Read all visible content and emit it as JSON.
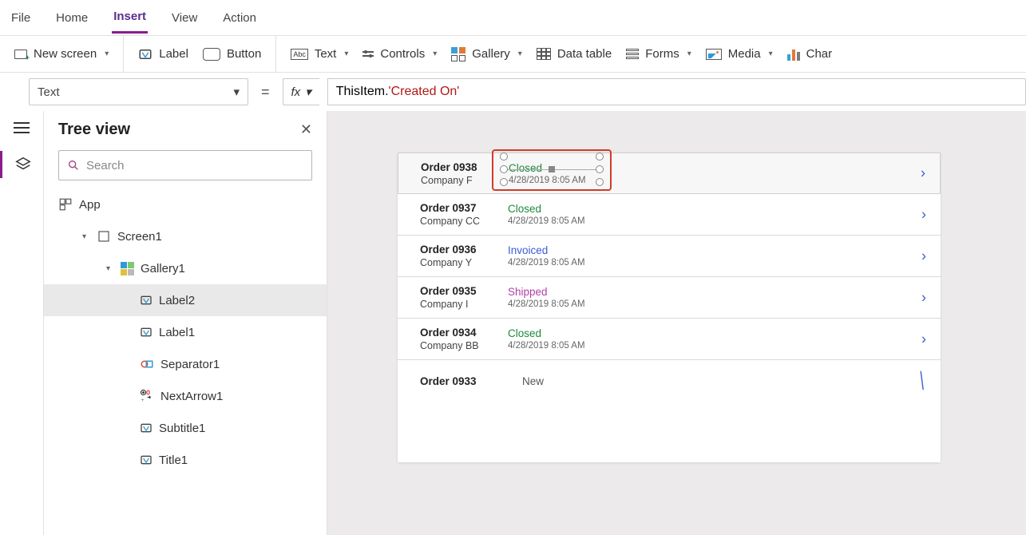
{
  "menu": {
    "file": "File",
    "home": "Home",
    "insert": "Insert",
    "view": "View",
    "action": "Action"
  },
  "ribbon": {
    "newscreen": "New screen",
    "label": "Label",
    "button": "Button",
    "text": "Text",
    "controls": "Controls",
    "gallery": "Gallery",
    "datatable": "Data table",
    "forms": "Forms",
    "media": "Media",
    "charts": "Char"
  },
  "fx": {
    "property": "Text",
    "thisitem": "ThisItem",
    "dot": ".",
    "field": "'Created On'"
  },
  "tree": {
    "title": "Tree view",
    "search_ph": "Search",
    "app": "App",
    "screen": "Screen1",
    "gallery": "Gallery1",
    "label2": "Label2",
    "label1": "Label1",
    "separator": "Separator1",
    "nextarrow": "NextArrow1",
    "subtitle": "Subtitle1",
    "titlectl": "Title1"
  },
  "orders": [
    {
      "id": "Order 0938",
      "company": "Company F",
      "status": "Closed",
      "statusClass": "closed",
      "ts": "4/28/2019 8:05 AM"
    },
    {
      "id": "Order 0937",
      "company": "Company CC",
      "status": "Closed",
      "statusClass": "closed",
      "ts": "4/28/2019 8:05 AM"
    },
    {
      "id": "Order 0936",
      "company": "Company Y",
      "status": "Invoiced",
      "statusClass": "invoiced",
      "ts": "4/28/2019 8:05 AM"
    },
    {
      "id": "Order 0935",
      "company": "Company I",
      "status": "Shipped",
      "statusClass": "shipped",
      "ts": "4/28/2019 8:05 AM"
    },
    {
      "id": "Order 0934",
      "company": "Company BB",
      "status": "Closed",
      "statusClass": "closed",
      "ts": "4/28/2019 8:05 AM"
    },
    {
      "id": "Order 0933",
      "company": "",
      "status": "New",
      "statusClass": "new",
      "ts": ""
    }
  ]
}
